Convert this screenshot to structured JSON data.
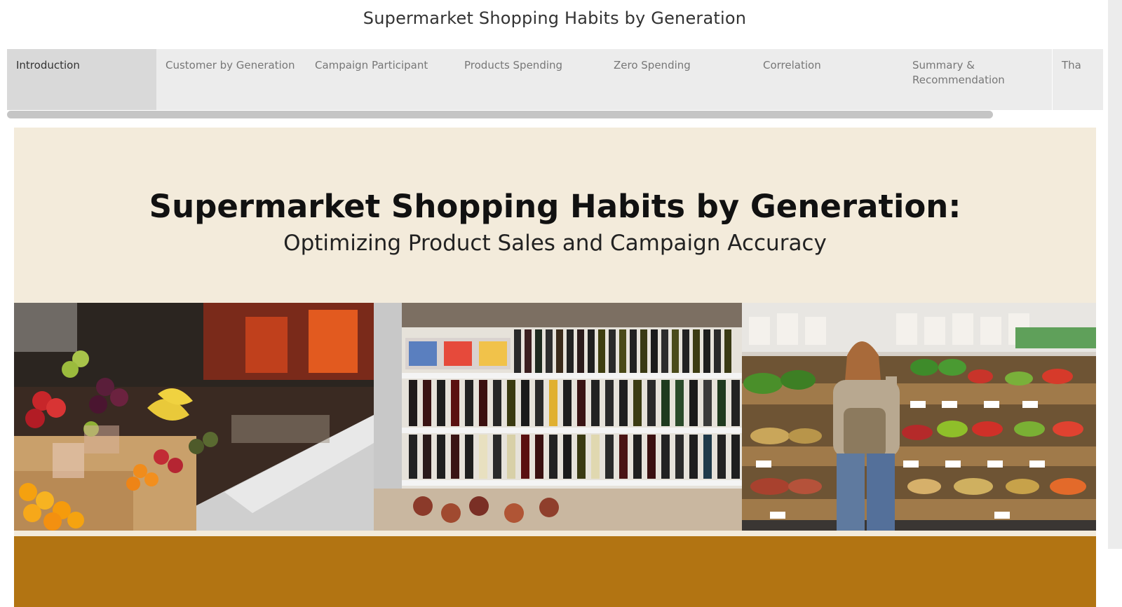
{
  "page": {
    "title": "Supermarket Shopping Habits by Generation"
  },
  "tabs": [
    {
      "label": "Introduction",
      "active": true
    },
    {
      "label": "Customer by Generation",
      "active": false
    },
    {
      "label": "Campaign Participant",
      "active": false
    },
    {
      "label": "Products Spending",
      "active": false
    },
    {
      "label": "Zero Spending",
      "active": false
    },
    {
      "label": "Correlation",
      "active": false
    },
    {
      "label": "Summary & Recommendation",
      "active": false
    },
    {
      "label": "Tha",
      "active": false
    }
  ],
  "hero": {
    "title": "Supermarket Shopping Habits by Generation:",
    "subtitle": "Optimizing Product Sales and Campaign Accuracy"
  },
  "photos": [
    {
      "subject": "fruit-market-stall-photo"
    },
    {
      "subject": "wine-shelves-photo"
    },
    {
      "subject": "shopper-vegetable-aisle-photo"
    }
  ],
  "colors": {
    "hero_background": "#f3ebdb",
    "accent_band": "#b27412",
    "active_tab": "#d9d9d9",
    "inactive_tab": "#ececec"
  }
}
